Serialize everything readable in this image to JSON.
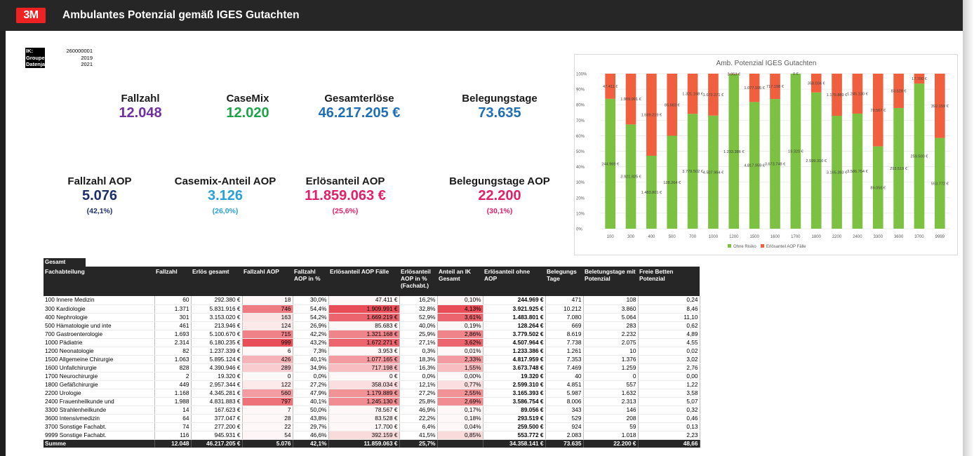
{
  "header": {
    "logo_text": "3M",
    "title": "Ambulantes Potenzial gemäß IGES Gutachten"
  },
  "info": [
    {
      "key": "IK:",
      "value": "260000001"
    },
    {
      "key": "Grouper:",
      "value": "2019"
    },
    {
      "key": "Datenjahr:",
      "value": "2021"
    }
  ],
  "kpis_top": [
    {
      "label": "Fallzahl",
      "value": "12.048",
      "color": "#7030a0"
    },
    {
      "label": "CaseMix",
      "value": "12.020",
      "color": "#1fa34a"
    },
    {
      "label": "Gesamterlöse",
      "value": "46.217.205 €",
      "color": "#1f6fb4"
    },
    {
      "label": "Belegungstage",
      "value": "73.635",
      "color": "#1f6fb4"
    }
  ],
  "kpis_bottom": [
    {
      "label": "Fallzahl AOP",
      "value": "5.076",
      "sub": "(42,1%)",
      "color": "#1f2f6b"
    },
    {
      "label": "Casemix-Anteil AOP",
      "value": "3.126",
      "sub": "(26,0%)",
      "color": "#2aa0d8"
    },
    {
      "label": "Erlösanteil AOP",
      "value": "11.859.063 €",
      "sub": "(25,6%)",
      "color": "#e0206a"
    },
    {
      "label": "Belegungstage AOP",
      "value": "22.200",
      "sub": "(30,1%)",
      "color": "#e0206a"
    }
  ],
  "chart_data": {
    "type": "bar",
    "stacked": true,
    "percent": true,
    "title": "Amb. Potenzial IGES Gutachten",
    "categories": [
      "100",
      "300",
      "400",
      "500",
      "700",
      "1000",
      "1200",
      "1500",
      "1600",
      "1700",
      "1800",
      "2200",
      "2400",
      "3300",
      "3600",
      "3700",
      "9999"
    ],
    "series": [
      {
        "name": "Ohne Risiko",
        "color": "#7dc142",
        "values": [
          244969,
          3921925,
          1483801,
          128264,
          3779502,
          4507964,
          1233386,
          4817959,
          3673748,
          19320,
          2599310,
          3165393,
          3586754,
          89056,
          293519,
          259500,
          553772
        ],
        "labels": [
          "244.969 €",
          "3.921.925 €",
          "1.483.801 €",
          "128.264 €",
          "3.779.502 €",
          "4.507.964 €",
          "1.233.386 €",
          "4.817.959 €",
          "3.673.748 €",
          "19.320 €",
          "2.599.310 €",
          "3.165.393 €",
          "3.586.754 €",
          "89.056 €",
          "293.519 €",
          "259.500 €",
          "553.772 €"
        ]
      },
      {
        "name": "Erlösanteil AOP Fälle",
        "color": "#f0603f",
        "values": [
          47411,
          1909991,
          1669219,
          85683,
          1321168,
          1672271,
          3953,
          1077165,
          717198,
          0,
          358034,
          1179889,
          1245130,
          78567,
          83528,
          17700,
          392159
        ],
        "labels": [
          "47.411 €",
          "1.909.991 €",
          "1.669.219 €",
          "85.683 €",
          "1.321.168 €",
          "1.672.271 €",
          "3.953 €",
          "1.077.165 €",
          "717.198 €",
          "0 €",
          "358.034 €",
          "1.179.889 €",
          "1.245.130 €",
          "78.567 €",
          "83.528 €",
          "17.700 €",
          "392.159 €"
        ]
      }
    ],
    "yticks": [
      "0%",
      "10%",
      "20%",
      "30%",
      "40%",
      "50%",
      "60%",
      "70%",
      "80%",
      "90%",
      "100%"
    ],
    "ylim": [
      0,
      100
    ],
    "legend_position": "bottom"
  },
  "table": {
    "tab": "Gesamt",
    "headers": [
      "Fachabteilung",
      "Fallzahl",
      "Erlös gesamt",
      "Fallzahl AOP",
      "Fallzahl AOP in %",
      "Erlösanteil AOP Fälle",
      "Erlösanteil AOP in % (Fachabt.)",
      "Anteil an IK Gesamt",
      "Erlösanteil ohne AOP",
      "Belegungs Tage",
      "Beletungstage mit Potenzial",
      "Freie Betten Potenzial"
    ],
    "rows": [
      [
        "100 Innere Medizin",
        "60",
        "292.380 €",
        "18",
        "30,0%",
        "47.411 €",
        "16,2%",
        "0,10%",
        "244.969 €",
        "471",
        "108",
        "0,24"
      ],
      [
        "300 Kardiologie",
        "1.371",
        "5.831.916 €",
        "746",
        "54,4%",
        "1.909.991 €",
        "32,8%",
        "4,13%",
        "3.921.925 €",
        "10.212",
        "3.860",
        "8,46"
      ],
      [
        "400 Nephrologie",
        "301",
        "3.153.020 €",
        "163",
        "54,2%",
        "1.669.219 €",
        "52,9%",
        "3,61%",
        "1.483.801 €",
        "7.080",
        "5.064",
        "11,10"
      ],
      [
        "500 Hämatologie und inte",
        "461",
        "213.946 €",
        "124",
        "26,9%",
        "85.683 €",
        "40,0%",
        "0,19%",
        "128.264 €",
        "669",
        "283",
        "0,62"
      ],
      [
        "700 Gastroenterologie",
        "1.693",
        "5.100.670 €",
        "715",
        "42,2%",
        "1.321.168 €",
        "25,9%",
        "2,86%",
        "3.779.502 €",
        "8.619",
        "2.232",
        "4,89"
      ],
      [
        "1000 Pädiatrie",
        "2.314",
        "6.180.235 €",
        "999",
        "43,2%",
        "1.672.271 €",
        "27,1%",
        "3,62%",
        "4.507.964 €",
        "7.738",
        "2.075",
        "4,55"
      ],
      [
        "1200 Neonatologie",
        "82",
        "1.237.339 €",
        "6",
        "7,3%",
        "3.953 €",
        "0,3%",
        "0,01%",
        "1.233.386 €",
        "1.261",
        "10",
        "0,02"
      ],
      [
        "1500 Allgemeine Chirurgie",
        "1.063",
        "5.895.124 €",
        "426",
        "40,1%",
        "1.077.165 €",
        "18,3%",
        "2,33%",
        "4.817.959 €",
        "7.353",
        "1.376",
        "3,02"
      ],
      [
        "1600 Unfallchirurgie",
        "828",
        "4.390.946 €",
        "289",
        "34,9%",
        "717.198 €",
        "16,3%",
        "1,55%",
        "3.673.748 €",
        "7.469",
        "1.259",
        "2,76"
      ],
      [
        "1700 Neurochirurgie",
        "2",
        "19.320 €",
        "0",
        "0,0%",
        "0 €",
        "0,0%",
        "0,00%",
        "19.320 €",
        "40",
        "0",
        "0,00"
      ],
      [
        "1800 Gefäßchirurgie",
        "449",
        "2.957.344 €",
        "122",
        "27,2%",
        "358.034 €",
        "12,1%",
        "0,77%",
        "2.599.310 €",
        "4.851",
        "557",
        "1,22"
      ],
      [
        "2200 Urologie",
        "1.168",
        "4.345.281 €",
        "560",
        "47,9%",
        "1.179.889 €",
        "27,2%",
        "2,55%",
        "3.165.393 €",
        "5.987",
        "1.632",
        "3,58"
      ],
      [
        "2400 Frauenheilkunde und",
        "1.988",
        "4.831.883 €",
        "797",
        "40,1%",
        "1.245.130 €",
        "25,8%",
        "2,69%",
        "3.586.754 €",
        "8.006",
        "2.313",
        "5,07"
      ],
      [
        "3300 Strahlenheilkunde",
        "14",
        "167.623 €",
        "7",
        "50,0%",
        "78.567 €",
        "46,9%",
        "0,17%",
        "89.056 €",
        "343",
        "146",
        "0,32"
      ],
      [
        "3600 Intensivmedizin",
        "64",
        "377.047 €",
        "28",
        "43,8%",
        "83.528 €",
        "22,2%",
        "0,18%",
        "293.519 €",
        "529",
        "208",
        "0,46"
      ],
      [
        "3700 Sonstige Fachabt.",
        "74",
        "277.200 €",
        "22",
        "29,7%",
        "17.700 €",
        "6,4%",
        "0,04%",
        "259.500 €",
        "924",
        "59",
        "0,13"
      ],
      [
        "9999 Sonstige Fachabt.",
        "116",
        "945.931 €",
        "54",
        "46,6%",
        "392.159 €",
        "41,5%",
        "0,85%",
        "553.772 €",
        "2.083",
        "1.018",
        "2,23"
      ]
    ],
    "heat": {
      "fallzahl_aop": [
        18,
        746,
        163,
        124,
        715,
        999,
        6,
        426,
        289,
        0,
        122,
        560,
        797,
        7,
        28,
        22,
        54
      ],
      "erloes_aop": [
        47411,
        1909991,
        1669219,
        85683,
        1321168,
        1672271,
        3953,
        1077165,
        717198,
        0,
        358034,
        1179889,
        1245130,
        78567,
        83528,
        17700,
        392159
      ],
      "anteil_ik": [
        0.1,
        4.13,
        3.61,
        0.19,
        2.86,
        3.62,
        0.01,
        2.33,
        1.55,
        0.0,
        0.77,
        2.55,
        2.69,
        0.17,
        0.18,
        0.04,
        0.85
      ],
      "color": "#e8454f"
    },
    "total": [
      "Summe",
      "12.048",
      "46.217.205 €",
      "5.076",
      "42,1%",
      "11.859.063 €",
      "25,7%",
      "",
      "34.358.141 €",
      "73.635",
      "22.200 €",
      "48,66"
    ]
  }
}
